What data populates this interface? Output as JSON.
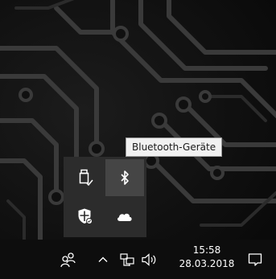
{
  "tooltip": {
    "text": "Bluetooth-Geräte"
  },
  "flyout": {
    "icons": [
      {
        "name": "usb-drive-icon"
      },
      {
        "name": "bluetooth-icon"
      },
      {
        "name": "windows-defender-icon"
      },
      {
        "name": "onedrive-cloud-icon"
      }
    ]
  },
  "taskbar": {
    "icons": [
      "people-icon",
      "chevron-up-icon",
      "network-icon",
      "volume-icon",
      "action-center-icon"
    ],
    "clock": {
      "time": "15:58",
      "date": "28.03.2018"
    }
  },
  "colors": {
    "taskbar": "#0d0d0d",
    "flyout": "#2c2c2c",
    "flyout_highlight": "#454545",
    "tooltip_bg": "#f1f1f1",
    "circuit_lines": "#3a3a3a"
  }
}
